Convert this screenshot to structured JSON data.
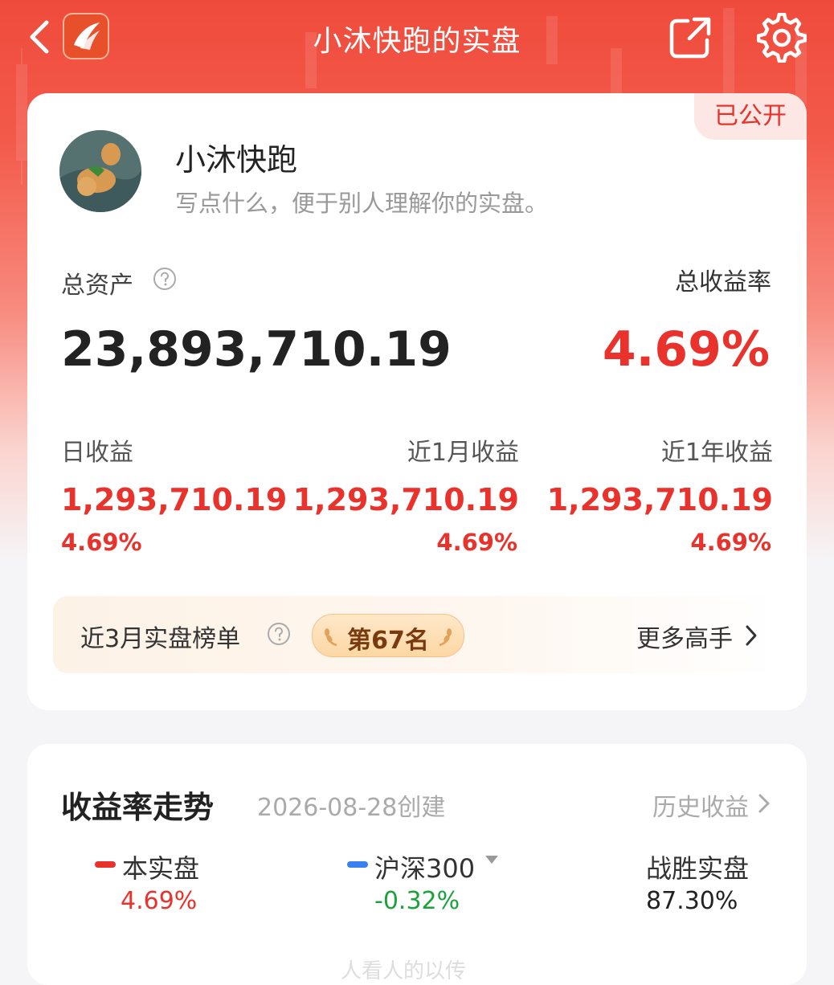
{
  "nav": {
    "title": "小沐快跑的实盘"
  },
  "profile": {
    "badge": "已公开",
    "name": "小沐快跑",
    "bio": "写点什么，便于别人理解你的实盘。"
  },
  "summary": {
    "assets_label": "总资产",
    "assets_value": "23,893,710.19",
    "ratio_label": "总收益率",
    "ratio_value": "4.69%"
  },
  "stats": [
    {
      "label": "日收益",
      "value": "1,293,710.19",
      "pct": "4.69%"
    },
    {
      "label": "近1月收益",
      "value": "1,293,710.19",
      "pct": "4.69%"
    },
    {
      "label": "近1年收益",
      "value": "1,293,710.19",
      "pct": "4.69%"
    }
  ],
  "rank": {
    "label": "近3月实盘榜单",
    "position": "第67名",
    "more": "更多高手"
  },
  "trend": {
    "title": "收益率走势",
    "created": "2026-08-28创建",
    "history": "历史收益",
    "legend": [
      {
        "name": "本实盘",
        "value": "4.69%",
        "color": "#e8322b"
      },
      {
        "name": "沪深300",
        "value": "-0.32%",
        "color": "#3a7ff0"
      },
      {
        "name": "战胜实盘",
        "value": "87.30%",
        "color": "#222222"
      }
    ],
    "faded_text": "人看人的以传"
  },
  "colors": {
    "accent_red": "#e8322b",
    "up_red": "#e8322b",
    "down_green": "#1aa33b",
    "link_blue": "#3a7ff0"
  }
}
